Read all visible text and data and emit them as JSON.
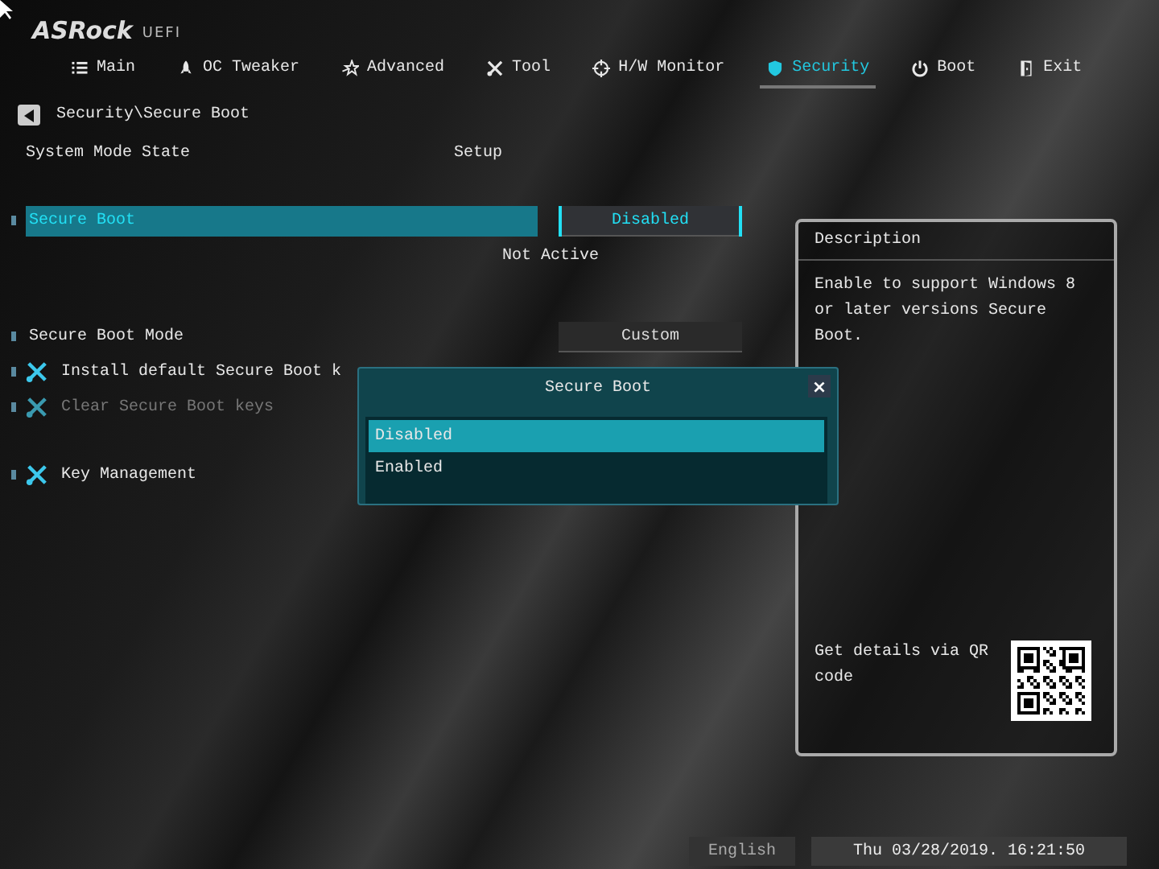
{
  "logo": {
    "brand": "ASRock",
    "suffix": "UEFI"
  },
  "tabs": [
    {
      "label": "Main",
      "selected": false
    },
    {
      "label": "OC Tweaker",
      "selected": false
    },
    {
      "label": "Advanced",
      "selected": false
    },
    {
      "label": "Tool",
      "selected": false
    },
    {
      "label": "H/W Monitor",
      "selected": false
    },
    {
      "label": "Security",
      "selected": true
    },
    {
      "label": "Boot",
      "selected": false
    },
    {
      "label": "Exit",
      "selected": false
    }
  ],
  "breadcrumb": "Security\\Secure Boot",
  "rows": [
    {
      "kind": "info",
      "label": "System Mode State",
      "value": "Setup"
    },
    {
      "kind": "option",
      "label": "Secure Boot",
      "value": "Disabled",
      "selected": true
    },
    {
      "kind": "note",
      "value": "Not Active"
    },
    {
      "kind": "option",
      "label": "Secure Boot Mode",
      "value": "Custom",
      "selected": false
    },
    {
      "kind": "action",
      "label": "Install default Secure Boot k",
      "disabled": false
    },
    {
      "kind": "action",
      "label": "Clear Secure Boot keys",
      "disabled": true
    },
    {
      "kind": "action",
      "label": "Key Management",
      "disabled": false
    }
  ],
  "popup": {
    "title": "Secure Boot",
    "close": "×",
    "options": [
      {
        "label": "Disabled",
        "selected": true
      },
      {
        "label": "Enabled",
        "selected": false
      }
    ]
  },
  "description": {
    "title": "Description",
    "text": "Enable to support Windows 8 or later versions Secure Boot.",
    "qr_text": "Get details via QR code"
  },
  "footer": {
    "language": "English",
    "datetime": "Thu 03/28/2019. 16:21:50"
  }
}
